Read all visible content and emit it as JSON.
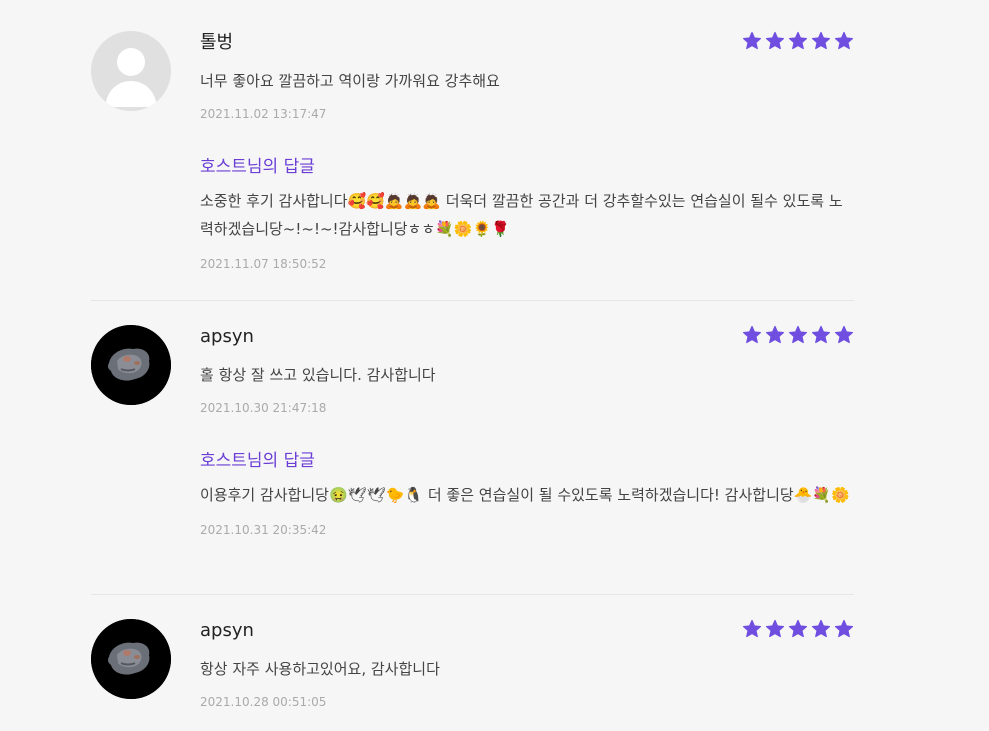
{
  "reviews": [
    {
      "nickname": "톨벙",
      "avatar": "default-avatar",
      "rating": 5,
      "text": "너무 좋아요 깔끔하고 역이랑 가까워요 강추해요",
      "date": "2021.11.02 13:17:47",
      "reply": {
        "title": "호스트님의 답글",
        "body": "소중한 후기 감사합니다🥰🥰🙇🙇🙇 더욱더 깔끔한 공간과 더 강추할수있는 연습실이 될수 있도록 노력하겠습니당~!~!~!감사합니당ㅎㅎ💐🌼🌻🌹",
        "date": "2021.11.07 18:50:52"
      }
    },
    {
      "nickname": "apsyn",
      "avatar": "photo-avatar",
      "rating": 5,
      "text": "홀 항상 잘 쓰고 있습니다. 감사합니다",
      "date": "2021.10.30 21:47:18",
      "reply": {
        "title": "호스트님의 답글",
        "body": "이용후기 감사합니당🤢🕊🕊🐤🐧 더 좋은 연습실이 될 수있도록 노력하겠습니다! 감사합니당🐣💐🌼",
        "date": "2021.10.31 20:35:42"
      }
    },
    {
      "nickname": "apsyn",
      "avatar": "photo-avatar",
      "rating": 5,
      "text": "항상 자주 사용하고있어요, 감사합니다",
      "date": "2021.10.28 00:51:05"
    }
  ],
  "colors": {
    "star": "#6f4ee0",
    "reply_title": "#6b3fd6"
  }
}
